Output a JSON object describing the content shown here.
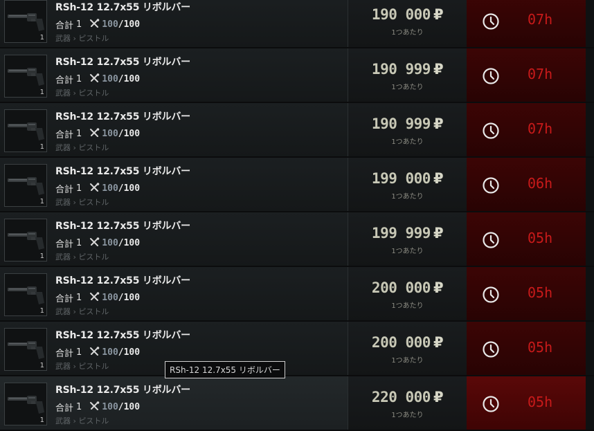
{
  "listings": [
    {
      "title": "RSh-12 12.7x55 リボルバー",
      "total_label": "合計",
      "total": "1",
      "durability": "100",
      "durability_max": "/100",
      "category": "武器",
      "subcategory": "ピストル",
      "quantity": "1",
      "price": "190 000",
      "currency": "₽",
      "per_unit": "1つあたり",
      "time_left": "07h",
      "highlighted": false
    },
    {
      "title": "RSh-12 12.7x55 リボルバー",
      "total_label": "合計",
      "total": "1",
      "durability": "100",
      "durability_max": "/100",
      "category": "武器",
      "subcategory": "ピストル",
      "quantity": "1",
      "price": "190 999",
      "currency": "₽",
      "per_unit": "1つあたり",
      "time_left": "07h",
      "highlighted": false
    },
    {
      "title": "RSh-12 12.7x55 リボルバー",
      "total_label": "合計",
      "total": "1",
      "durability": "100",
      "durability_max": "/100",
      "category": "武器",
      "subcategory": "ピストル",
      "quantity": "1",
      "price": "190 999",
      "currency": "₽",
      "per_unit": "1つあたり",
      "time_left": "07h",
      "highlighted": false
    },
    {
      "title": "RSh-12 12.7x55 リボルバー",
      "total_label": "合計",
      "total": "1",
      "durability": "100",
      "durability_max": "/100",
      "category": "武器",
      "subcategory": "ピストル",
      "quantity": "1",
      "price": "199 000",
      "currency": "₽",
      "per_unit": "1つあたり",
      "time_left": "06h",
      "highlighted": false
    },
    {
      "title": "RSh-12 12.7x55 リボルバー",
      "total_label": "合計",
      "total": "1",
      "durability": "100",
      "durability_max": "/100",
      "category": "武器",
      "subcategory": "ピストル",
      "quantity": "1",
      "price": "199 999",
      "currency": "₽",
      "per_unit": "1つあたり",
      "time_left": "05h",
      "highlighted": false
    },
    {
      "title": "RSh-12 12.7x55 リボルバー",
      "total_label": "合計",
      "total": "1",
      "durability": "100",
      "durability_max": "/100",
      "category": "武器",
      "subcategory": "ピストル",
      "quantity": "1",
      "price": "200 000",
      "currency": "₽",
      "per_unit": "1つあたり",
      "time_left": "05h",
      "highlighted": false
    },
    {
      "title": "RSh-12 12.7x55 リボルバー",
      "total_label": "合計",
      "total": "1",
      "durability": "100",
      "durability_max": "/100",
      "category": "武器",
      "subcategory": "ピストル",
      "quantity": "1",
      "price": "200 000",
      "currency": "₽",
      "per_unit": "1つあたり",
      "time_left": "05h",
      "highlighted": false
    },
    {
      "title": "RSh-12 12.7x55 リボルバー",
      "total_label": "合計",
      "total": "1",
      "durability": "100",
      "durability_max": "/100",
      "category": "武器",
      "subcategory": "ピストル",
      "quantity": "1",
      "price": "220 000",
      "currency": "₽",
      "per_unit": "1つあたり",
      "time_left": "05h",
      "highlighted": true
    }
  ],
  "tooltip": {
    "text": "RSh-12 12.7x55 リボルバー"
  },
  "icons": {
    "item": "revolver-icon",
    "durability": "tools-icon",
    "time": "clock-icon",
    "currency": "ruble-icon"
  },
  "colors": {
    "price": "#c8c8b6",
    "time_left": "#c81a1a",
    "time_bg": "#3c0505",
    "durability": "#8a95a0"
  }
}
